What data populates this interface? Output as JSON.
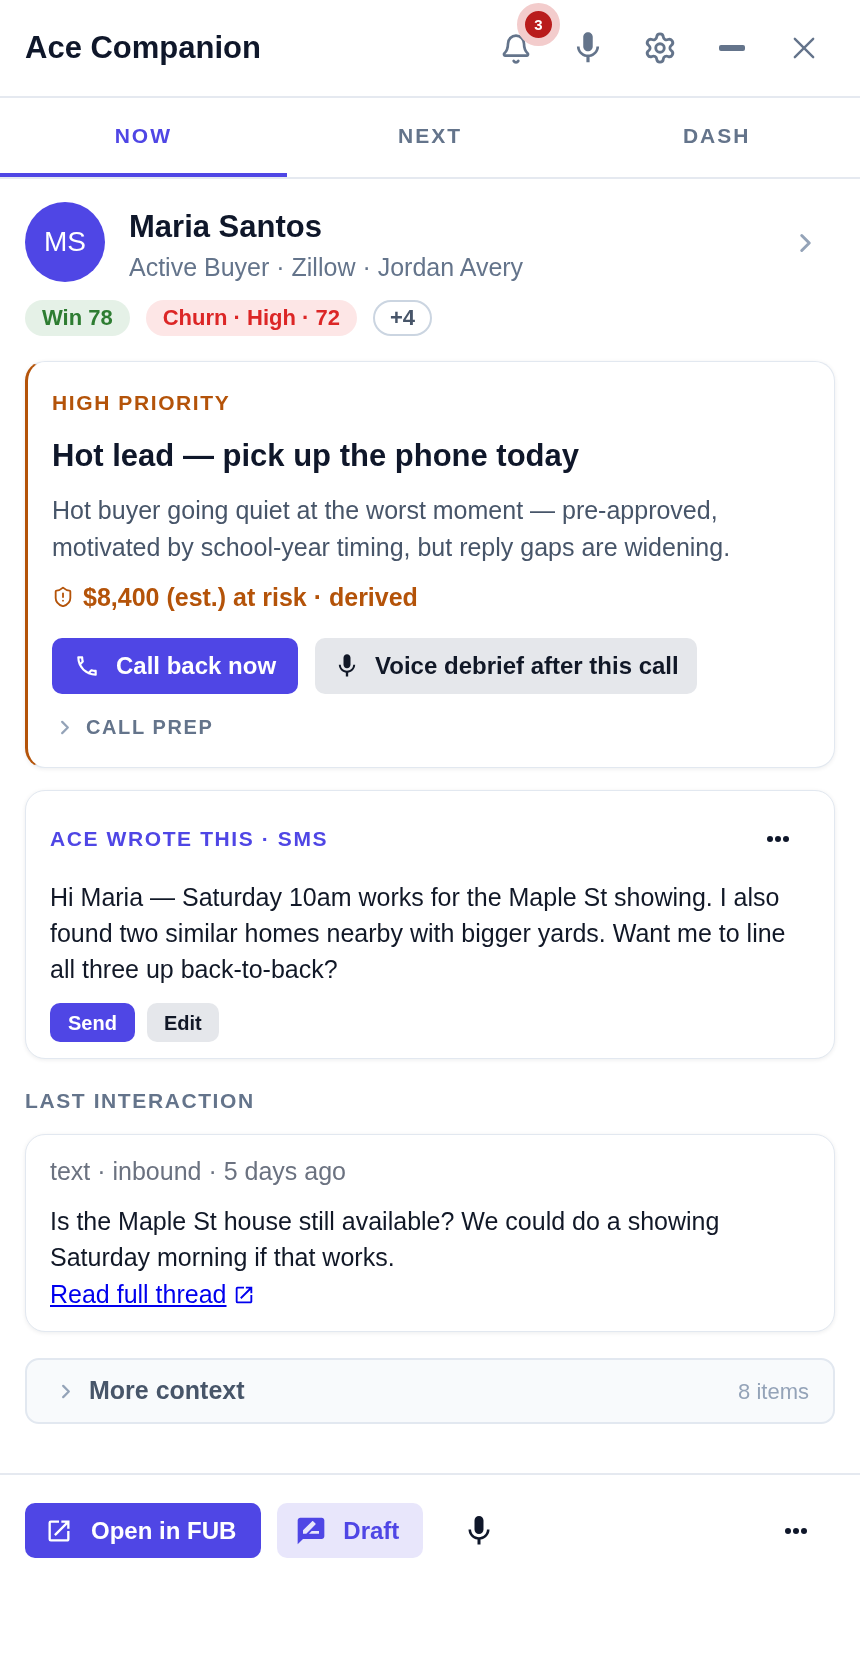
{
  "header": {
    "title": "Ace Companion",
    "notification_count": "3"
  },
  "tabs": [
    {
      "label": "NOW",
      "selected": true
    },
    {
      "label": "NEXT",
      "selected": false
    },
    {
      "label": "DASH",
      "selected": false
    }
  ],
  "contact": {
    "initials": "MS",
    "name": "Maria Santos",
    "details": "Active Buyer · Zillow · Jordan Avery",
    "tags": [
      {
        "kind": "win",
        "label": "Win 78"
      },
      {
        "kind": "churn",
        "label": "Churn · High · 72"
      },
      {
        "kind": "more",
        "label": "+4"
      }
    ]
  },
  "priority_card": {
    "eyebrow": "HIGH PRIORITY",
    "title": "Hot lead — pick up the phone today",
    "body": "Hot buyer going quiet at the worst moment — pre-approved, motivated by school-year timing, but reply gaps are widening.",
    "risk": "$8,400 (est.) at risk · derived",
    "actions": [
      {
        "kind": "call",
        "label": "Call back now"
      },
      {
        "kind": "voice",
        "label": "Voice debrief after this call"
      }
    ],
    "call_prep": {
      "label": "CALL PREP",
      "expanded": false
    }
  },
  "draft_card": {
    "eyebrow": "ACE WROTE THIS · SMS",
    "message": "Hi Maria — Saturday 10am works for the Maple St showing. I also found two similar homes nearby with bigger yards. Want me to line all three up back-to-back?",
    "actions": [
      {
        "kind": "send",
        "label": "Send"
      },
      {
        "kind": "edit",
        "label": "Edit"
      }
    ]
  },
  "last_interaction": {
    "heading": "LAST INTERACTION",
    "meta": "text · inbound · 5 days ago",
    "message": "Is the Maple St house still available? We could do a showing Saturday morning if that works.",
    "link": "Read full thread"
  },
  "more_context": {
    "label": "More context",
    "count": "8 items",
    "expanded": false
  },
  "bottom_bar": {
    "actions": [
      {
        "kind": "open",
        "label": "Open in FUB"
      },
      {
        "kind": "draft",
        "label": "Draft"
      },
      {
        "kind": "voice"
      },
      {
        "kind": "more"
      }
    ]
  }
}
